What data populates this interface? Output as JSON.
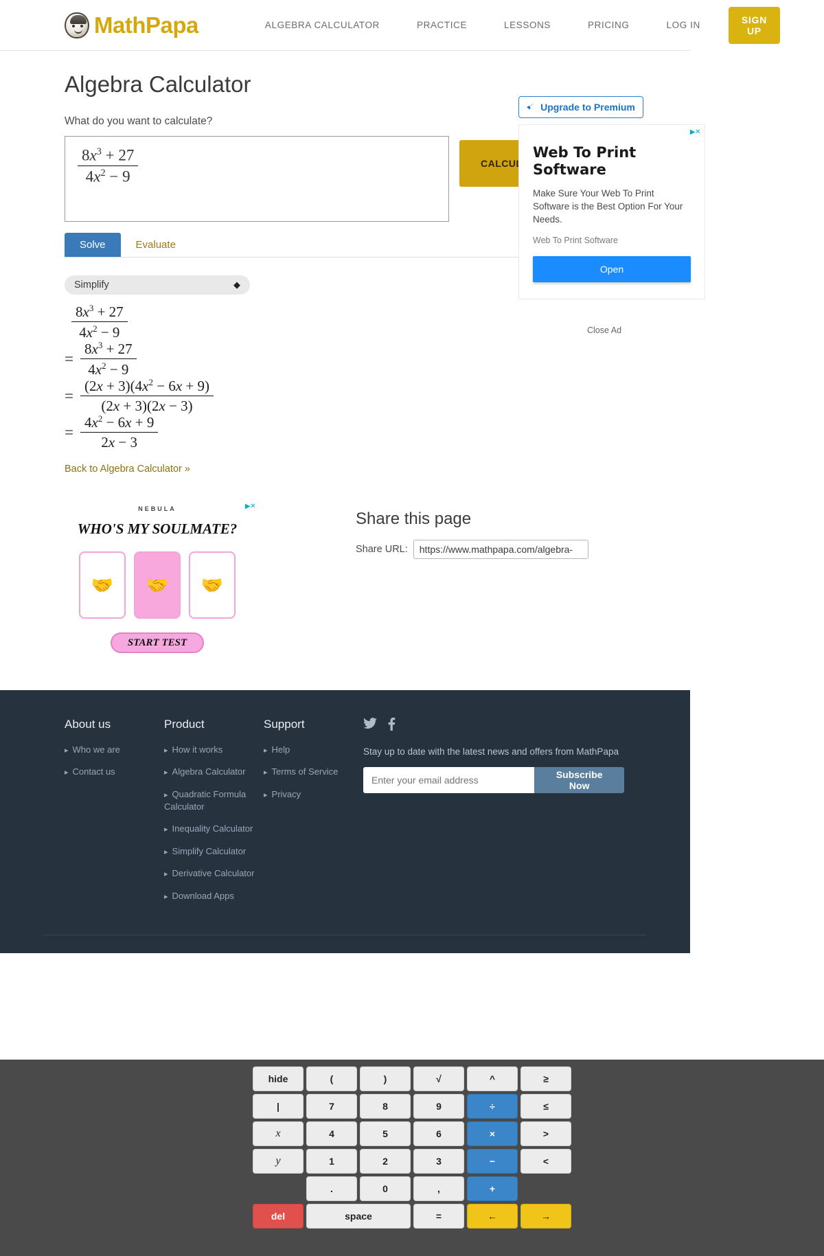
{
  "header": {
    "logo_text": "MathPapa",
    "nav": [
      {
        "label": "ALGEBRA CALCULATOR"
      },
      {
        "label": "PRACTICE"
      },
      {
        "label": "LESSONS"
      },
      {
        "label": "PRICING"
      },
      {
        "label": "LOG IN"
      }
    ],
    "signup_label": "SIGN UP",
    "brand_color": "#d4a910"
  },
  "main": {
    "page_title": "Algebra Calculator",
    "question_label": "What do you want to calculate?",
    "input_expression": {
      "numerator": "8x^3 + 27",
      "denominator": "4x^2 - 9"
    },
    "calculate_label": "CALCULATE IT!",
    "tabs": [
      {
        "label": "Solve",
        "active": true
      },
      {
        "label": "Evaluate",
        "active": false
      }
    ],
    "mode_select": {
      "value": "Simplify",
      "icon": "chevron-updown-icon"
    },
    "solution_steps": [
      {
        "eq": "",
        "numerator": "8x^3 + 27",
        "denominator": "4x^2 - 9"
      },
      {
        "eq": "=",
        "numerator": "8x^3 + 27",
        "denominator": "4x^2 - 9"
      },
      {
        "eq": "=",
        "numerator": "(2x + 3)(4x^2 - 6x + 9)",
        "denominator": "(2x + 3)(2x - 3)"
      },
      {
        "eq": "=",
        "numerator": "4x^2 - 6x + 9",
        "denominator": "2x - 3"
      }
    ],
    "back_link": "Back to Algebra Calculator »"
  },
  "rail": {
    "upgrade_label": "Upgrade to Premium",
    "upgrade_icon": "rocket-icon",
    "ad": {
      "marker": "▶✕",
      "title": "Web To Print Software",
      "description": "Make Sure Your Web To Print Software is the Best Option For Your Needs.",
      "source": "Web To Print Software",
      "cta": "Open"
    },
    "close_ad": "Close Ad"
  },
  "lower_ad": {
    "marker": "▶✕",
    "brand": "NEBULA",
    "headline": "WHO'S MY SOULMATE?",
    "cards": [
      "🤝",
      "🤝",
      "🤝"
    ],
    "cta": "START TEST"
  },
  "share": {
    "title": "Share this page",
    "label": "Share URL:",
    "url": "https://www.mathpapa.com/algebra-"
  },
  "footer": {
    "columns": [
      {
        "heading": "About us",
        "links": [
          "Who we are",
          "Contact us"
        ]
      },
      {
        "heading": "Product",
        "links": [
          "How it works",
          "Algebra Calculator",
          "Quadratic Formula Calculator",
          "Inequality Calculator",
          "Simplify Calculator",
          "Derivative Calculator",
          "Download Apps"
        ]
      },
      {
        "heading": "Support",
        "links": [
          "Help",
          "Terms of Service",
          "Privacy"
        ]
      }
    ],
    "social": [
      {
        "name": "twitter-icon"
      },
      {
        "name": "facebook-icon"
      }
    ],
    "newsletter_text": "Stay up to date with the latest news and offers from MathPapa",
    "email_placeholder": "Enter your email address",
    "subscribe_label": "Subscribe Now"
  },
  "keyboard": {
    "rows": [
      [
        {
          "label": "hide",
          "style": "plain"
        },
        {
          "label": "(",
          "style": "plain"
        },
        {
          "label": ")",
          "style": "plain"
        },
        {
          "label": "√",
          "style": "plain"
        },
        {
          "label": "^",
          "style": "plain"
        },
        {
          "label": "≥",
          "style": "plain"
        }
      ],
      [
        {
          "label": "|",
          "style": "plain"
        },
        {
          "label": "7",
          "style": "plain"
        },
        {
          "label": "8",
          "style": "plain"
        },
        {
          "label": "9",
          "style": "plain"
        },
        {
          "label": "÷",
          "style": "blue"
        },
        {
          "label": "≤",
          "style": "plain"
        }
      ],
      [
        {
          "label": "x",
          "style": "italic"
        },
        {
          "label": "4",
          "style": "plain"
        },
        {
          "label": "5",
          "style": "plain"
        },
        {
          "label": "6",
          "style": "plain"
        },
        {
          "label": "×",
          "style": "blue"
        },
        {
          "label": ">",
          "style": "plain"
        }
      ],
      [
        {
          "label": "y",
          "style": "italic"
        },
        {
          "label": "1",
          "style": "plain"
        },
        {
          "label": "2",
          "style": "plain"
        },
        {
          "label": "3",
          "style": "plain"
        },
        {
          "label": "−",
          "style": "blue"
        },
        {
          "label": "<",
          "style": "plain"
        }
      ],
      [
        {
          "label": "",
          "style": "blank"
        },
        {
          "label": ".",
          "style": "plain"
        },
        {
          "label": "0",
          "style": "plain"
        },
        {
          "label": ",",
          "style": "plain"
        },
        {
          "label": "+",
          "style": "blue"
        },
        {
          "label": "",
          "style": "blank"
        }
      ],
      [
        {
          "label": "del",
          "style": "red"
        },
        {
          "label": "space",
          "style": "wide"
        },
        {
          "label": "=",
          "style": "plain"
        },
        {
          "label": "←",
          "style": "yellow"
        },
        {
          "label": "→",
          "style": "yellow"
        }
      ]
    ]
  }
}
